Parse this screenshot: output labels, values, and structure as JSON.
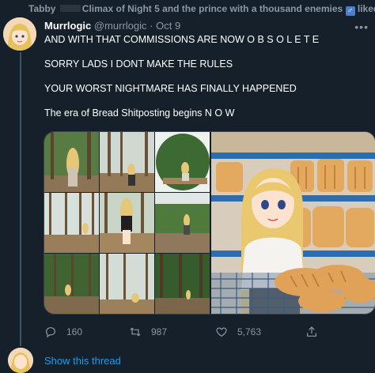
{
  "social_context": {
    "liker": "Tabby",
    "text": "Climax of Night 5 and the prince with a thousand enemies",
    "emoji": "♂",
    "suffix": "liked",
    "icon": "heart-icon"
  },
  "tweet": {
    "display_name": "Murrlogic",
    "handle": "@murrlogic",
    "separator": "·",
    "date": "Oct 9",
    "more_icon": "more-icon",
    "lines": [
      "AND WITH THAT COMMISSIONS ARE NOW O B S O L E T E",
      "SORRY LADS I DONT MAKE THE RULES",
      "YOUR WORST NIGHTMARE HAS FINALLY HAPPENED",
      "The era of Bread Shitposting begins N O W"
    ]
  },
  "media": {
    "grid_images": 9,
    "colors": {
      "forest": "#3f5a2e",
      "trunk": "#6b5236",
      "sky": "#dfe8e6",
      "ground": "#8a7556",
      "hair": "#e8c86e",
      "store": "#2b6cb3",
      "bread": "#d99a4c"
    }
  },
  "actions": {
    "reply": {
      "icon": "reply-icon",
      "count": "160"
    },
    "retweet": {
      "icon": "retweet-icon",
      "count": "987"
    },
    "like": {
      "icon": "heart-icon",
      "count": "5,763"
    },
    "share": {
      "icon": "share-icon"
    }
  },
  "show_thread": "Show this thread"
}
